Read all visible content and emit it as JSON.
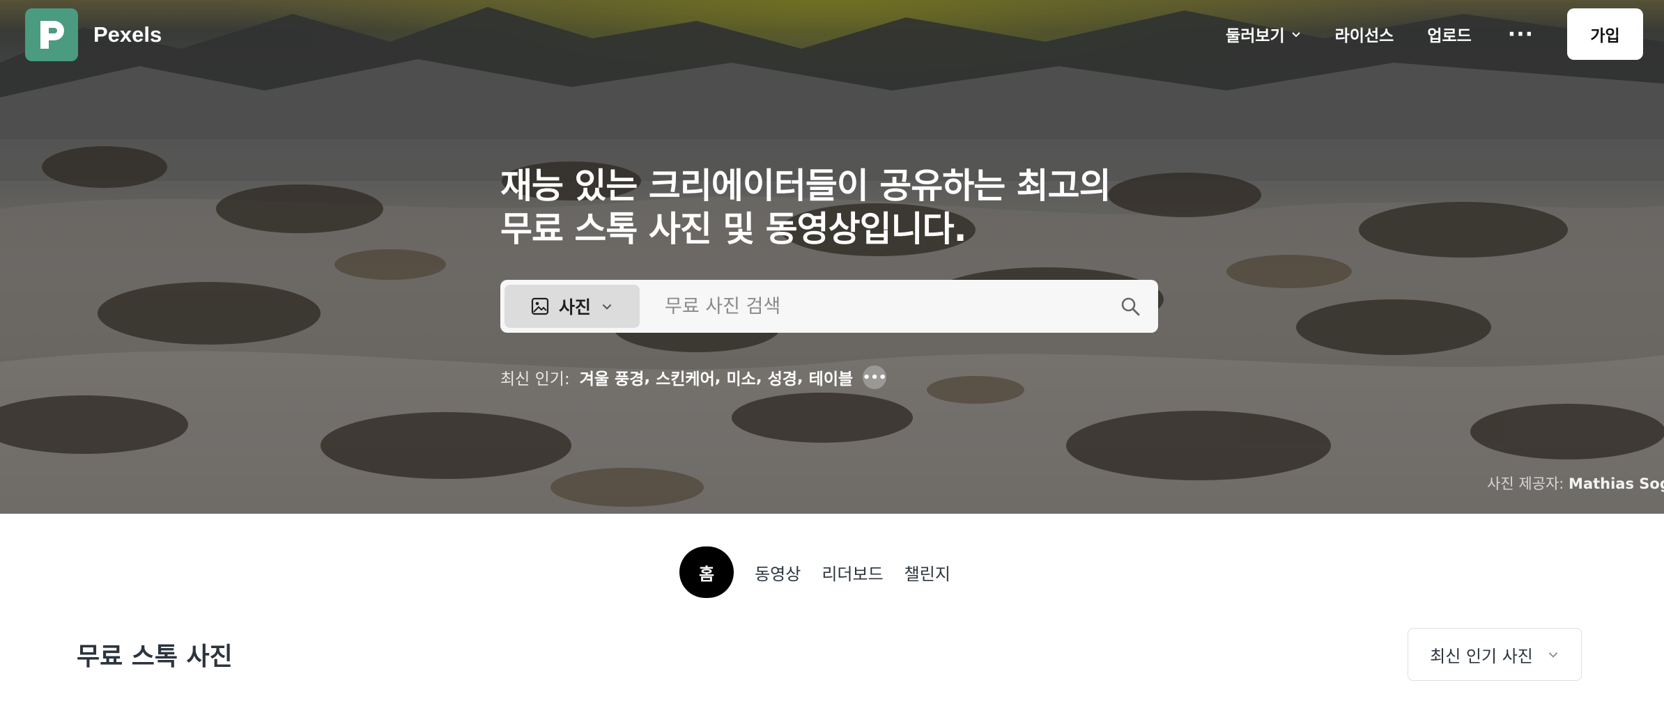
{
  "brand": {
    "name": "Pexels",
    "color": "#4a9b7f"
  },
  "nav": {
    "browse": "둘러보기",
    "license": "라이선스",
    "upload": "업로드",
    "more": "···",
    "join": "가입"
  },
  "hero": {
    "headline_line1": "재능 있는 크리에이터들이 공유하는 최고의",
    "headline_line2": "무료 스톡 사진 및 동영상입니다.",
    "search": {
      "type_label": "사진",
      "placeholder": "무료 사진 검색"
    },
    "trending": {
      "label": "최신 인기:",
      "tags": [
        "겨울 풍경",
        "스킨케어",
        "미소",
        "성경",
        "테이블"
      ]
    },
    "credit": {
      "prefix": "사진 제공자:",
      "author": "Mathias Sogo"
    }
  },
  "tabs": [
    "홈",
    "동영상",
    "리더보드",
    "챌린지"
  ],
  "section": {
    "title": "무료 스톡 사진",
    "sort_label": "최신 인기 사진"
  },
  "icons": {
    "logo": "pexels-logo-icon",
    "browse_chevron": "chevron-down-icon",
    "photo_type": "image-icon",
    "search": "search-icon",
    "sort_chevron": "chevron-down-icon"
  }
}
